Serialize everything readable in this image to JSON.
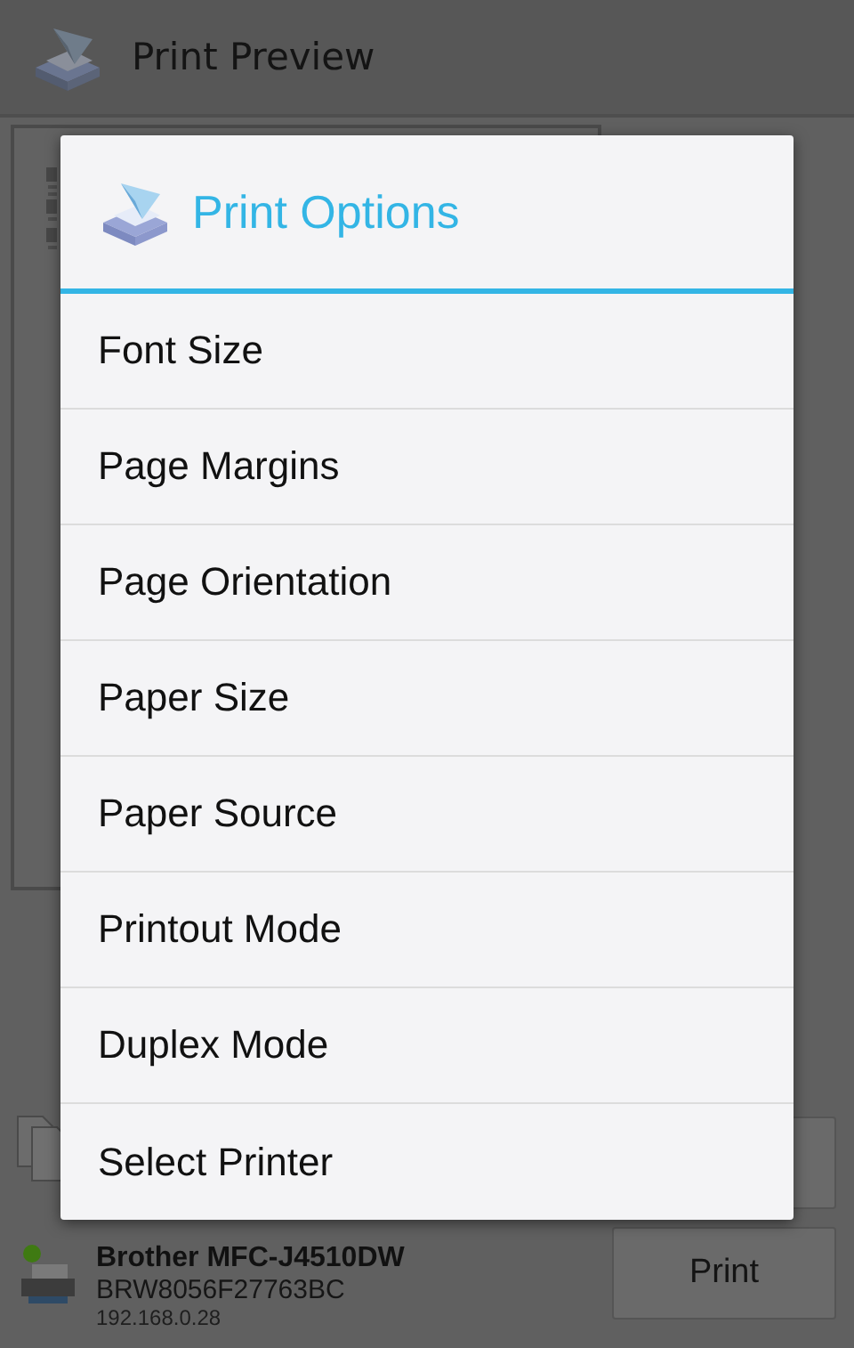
{
  "app_bar": {
    "title": "Print Preview"
  },
  "printer": {
    "name": "Brother MFC-J4510DW",
    "id": "BRW8056F27763BC",
    "address": "192.168.0.28",
    "online": true
  },
  "print_button": {
    "label": "Print"
  },
  "dialog": {
    "title": "Print Options",
    "items": [
      {
        "label": "Font Size"
      },
      {
        "label": "Page Margins"
      },
      {
        "label": "Page Orientation"
      },
      {
        "label": "Paper Size"
      },
      {
        "label": "Paper Source"
      },
      {
        "label": "Printout Mode"
      },
      {
        "label": "Duplex Mode"
      },
      {
        "label": "Select Printer"
      }
    ]
  }
}
